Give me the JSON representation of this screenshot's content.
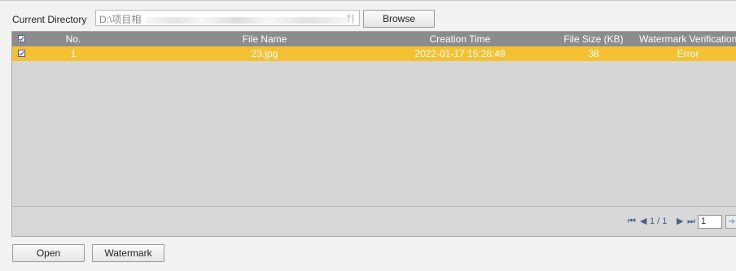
{
  "directory": {
    "label": "Current Directory",
    "path": "D:\\项目相",
    "path_tail": "†|",
    "browse_label": "Browse"
  },
  "table": {
    "headers": [
      "No.",
      "File Name",
      "Creation Time",
      "File Size (KB)",
      "Watermark Verification"
    ],
    "header_checked": true,
    "rows": [
      {
        "checked": true,
        "no": "1",
        "file_name": "23.jpg",
        "creation_time": "2022-01-17 15:28:49",
        "size_kb": "38",
        "watermark": "Error"
      }
    ],
    "selected_row_color": "#f5c032",
    "header_color": "#8c8c8c"
  },
  "pager": {
    "first_icon": "first-page-icon",
    "prev_icon": "prev-page-icon",
    "page_text": "1 / 1",
    "next_icon": "next-page-icon",
    "last_icon": "last-page-icon",
    "page_input": "1",
    "go_icon": "go-arrow-icon"
  },
  "actions": {
    "open_label": "Open",
    "watermark_label": "Watermark"
  }
}
